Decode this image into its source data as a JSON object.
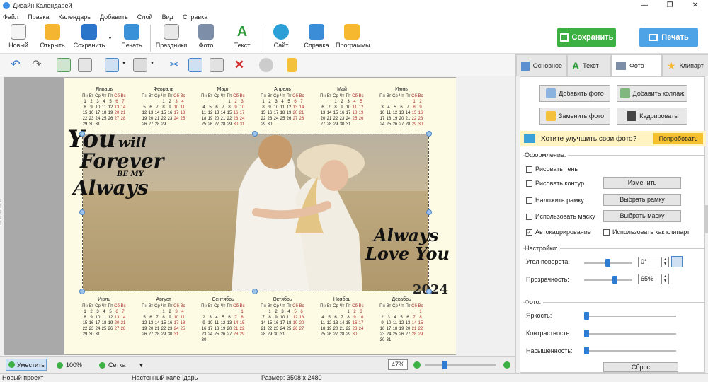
{
  "window": {
    "title": "Дизайн Календарей"
  },
  "menu": [
    "Файл",
    "Правка",
    "Календарь",
    "Добавить",
    "Слой",
    "Вид",
    "Справка"
  ],
  "toolbar": {
    "items": [
      {
        "id": "new",
        "label": "Новый",
        "icon": "new-document-icon"
      },
      {
        "id": "open",
        "label": "Открыть",
        "icon": "folder-icon"
      },
      {
        "id": "save",
        "label": "Сохранить",
        "icon": "floppy-icon"
      },
      {
        "id": "print",
        "label": "Печать",
        "icon": "printer-icon"
      },
      {
        "id": "holidays",
        "label": "Праздники",
        "icon": "calendar-icon"
      },
      {
        "id": "photo",
        "label": "Фото",
        "icon": "camera-icon"
      },
      {
        "id": "text",
        "label": "Текст",
        "icon": "text-a-icon"
      },
      {
        "id": "site",
        "label": "Сайт",
        "icon": "globe-icon"
      },
      {
        "id": "help",
        "label": "Справка",
        "icon": "book-icon"
      },
      {
        "id": "programs",
        "label": "Программы",
        "icon": "gift-icon"
      }
    ],
    "save_big": "Сохранить",
    "print_big": "Печать"
  },
  "calendar": {
    "weekdays": [
      "Пн",
      "Вт",
      "Ср",
      "Чт",
      "Пт",
      "Сб",
      "Вс"
    ],
    "year": "2024",
    "months": [
      {
        "name": "Январь",
        "start": 0,
        "days": 31
      },
      {
        "name": "Февраль",
        "start": 3,
        "days": 29
      },
      {
        "name": "Март",
        "start": 4,
        "days": 31
      },
      {
        "name": "Апрель",
        "start": 0,
        "days": 30
      },
      {
        "name": "Май",
        "start": 2,
        "days": 31
      },
      {
        "name": "Июнь",
        "start": 5,
        "days": 30
      },
      {
        "name": "Июль",
        "start": 0,
        "days": 31
      },
      {
        "name": "Август",
        "start": 3,
        "days": 31
      },
      {
        "name": "Сентябрь",
        "start": 6,
        "days": 30
      },
      {
        "name": "Октябрь",
        "start": 1,
        "days": 31
      },
      {
        "name": "Ноябрь",
        "start": 4,
        "days": 30
      },
      {
        "name": "Декабрь",
        "start": 6,
        "days": 31
      }
    ],
    "quote_left": [
      "You",
      "will",
      "Forever",
      "BE MY",
      "Always"
    ],
    "quote_right": [
      "Always",
      "Love You"
    ]
  },
  "status": {
    "fit": "Уместить",
    "zoom100": "100%",
    "grid": "Сетка",
    "zoom": "47%"
  },
  "bottom": {
    "project": "Новый проект",
    "type": "Настенный календарь",
    "size": "Размер: 3508 x 2480"
  },
  "panel": {
    "tabs": [
      {
        "label": "Основное",
        "icon": "layout-icon",
        "active": false
      },
      {
        "label": "Текст",
        "icon": "text-a-icon",
        "active": false
      },
      {
        "label": "Фото",
        "icon": "camera-icon",
        "active": true
      },
      {
        "label": "Клипарт",
        "icon": "star-icon",
        "active": false
      }
    ],
    "add_photo": "Добавить фото",
    "add_collage": "Добавить коллаж",
    "replace_photo": "Заменить фото",
    "crop": "Кадрировать",
    "improve_q": "Хотите улучшить свои фото?",
    "try": "Попробовать",
    "design": "Оформление:",
    "shadow": "Рисовать тень",
    "outline": "Рисовать контур",
    "change": "Изменить",
    "frame": "Наложить рамку",
    "choose_frame": "Выбрать рамку",
    "mask": "Использовать маску",
    "choose_mask": "Выбрать маску",
    "autocrop": "Автокадрирование",
    "as_clipart": "Использовать как клипарт",
    "settings": "Настройки:",
    "rotation": "Угол поворота:",
    "rotation_val": "0°",
    "opacity": "Прозрачность:",
    "opacity_val": "65%",
    "photo_section": "Фото:",
    "brightness": "Яркость:",
    "contrast": "Контрастность:",
    "saturation": "Насыщенность:",
    "reset": "Сброс"
  },
  "colors": {
    "green": "#3cb043",
    "blue": "#4da3e6"
  }
}
